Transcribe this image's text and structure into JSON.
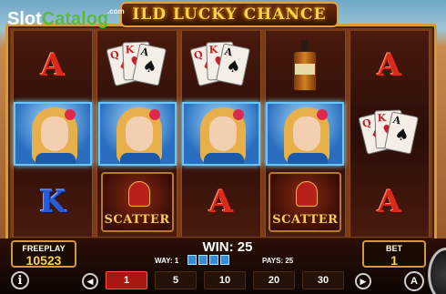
{
  "watermark": {
    "part1": "Slot",
    "part2": "Catalog",
    "suffix": ".com"
  },
  "game": {
    "title": "ILD LUCKY CHANCE"
  },
  "reels": [
    [
      "A",
      "lady",
      "K"
    ],
    [
      "cards",
      "lady",
      "scatter"
    ],
    [
      "cards",
      "lady",
      "A"
    ],
    [
      "bottle",
      "lady",
      "scatter"
    ],
    [
      "A",
      "cards",
      "A"
    ]
  ],
  "symbols": {
    "scatter_label": "SCATTER"
  },
  "freeplay": {
    "label": "FREEPLAY",
    "value": "10523"
  },
  "bet": {
    "label": "BET",
    "value": "1"
  },
  "win": {
    "text": "WIN: 25"
  },
  "way": {
    "text": "WAY: 1"
  },
  "pays": {
    "text": "PAYS: 25"
  },
  "bet_options": [
    "1",
    "5",
    "10",
    "20",
    "30"
  ],
  "selected_bet_index": 0,
  "icons": {
    "info": "i",
    "prev": "◀",
    "next": "▶",
    "auto": "A"
  }
}
